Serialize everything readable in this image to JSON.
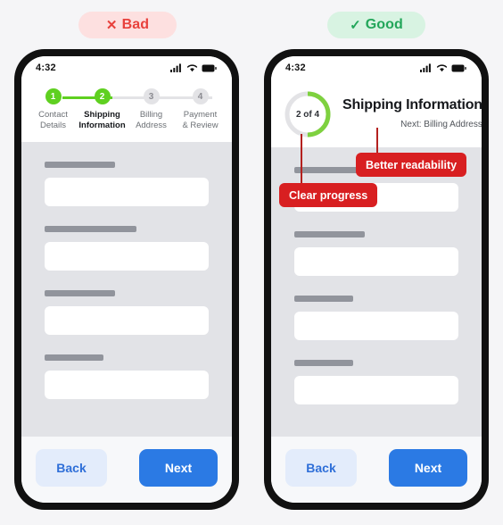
{
  "page": {
    "background": "#f5f5f7",
    "accent_green": "#5fd020",
    "accent_blue": "#2b7ae4",
    "accent_red": "#d81f21"
  },
  "badges": {
    "bad": {
      "mark": "✕",
      "label": "Bad",
      "bg": "#fde0e0",
      "color": "#e8413c"
    },
    "good": {
      "mark": "✓",
      "label": "Good",
      "bg": "#d8f3e2",
      "color": "#23a65a"
    }
  },
  "status_bar": {
    "time": "4:32",
    "icons": [
      "signal-icon",
      "wifi-icon",
      "battery-icon"
    ]
  },
  "bad_phone": {
    "stepper": {
      "steps": [
        {
          "number": "1",
          "label": "Contact\nDetails",
          "state": "done"
        },
        {
          "number": "2",
          "label": "Shipping\nInformation",
          "state": "current"
        },
        {
          "number": "3",
          "label": "Billing\nAddress",
          "state": "upcoming"
        },
        {
          "number": "4",
          "label": "Payment\n& Review",
          "state": "upcoming"
        }
      ]
    },
    "fields": [
      {
        "label_width": "43%"
      },
      {
        "label_width": "56%"
      },
      {
        "label_width": "43%"
      },
      {
        "label_width": "36%"
      }
    ],
    "footer": {
      "back": "Back",
      "next": "Next"
    }
  },
  "good_phone": {
    "ring": {
      "text": "2 of 4",
      "current": 2,
      "total": 4,
      "percent": 50,
      "track_color": "#e3e3e6",
      "fill_color": "#7ed13f"
    },
    "title": "Shipping Information",
    "subtitle": "Next: Billing Address",
    "fields": [
      {
        "label_width": "43%"
      },
      {
        "label_width": "43%"
      },
      {
        "label_width": "36%"
      },
      {
        "label_width": "36%"
      }
    ],
    "footer": {
      "back": "Back",
      "next": "Next"
    }
  },
  "annotations": [
    {
      "id": "better-readability",
      "text": "Better readability"
    },
    {
      "id": "clear-progress",
      "text": "Clear progress"
    }
  ]
}
